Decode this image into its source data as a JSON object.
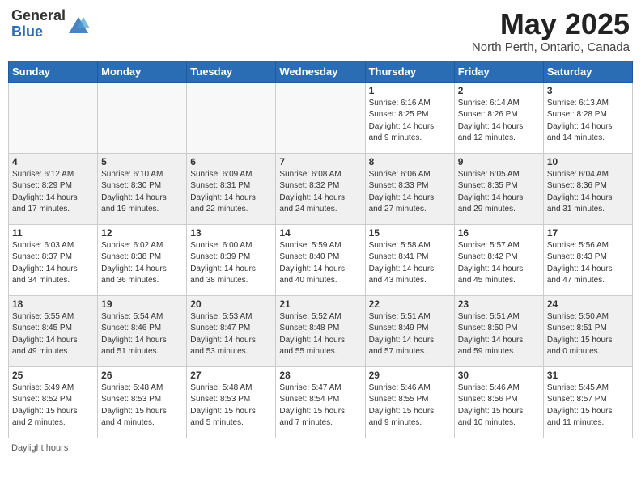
{
  "header": {
    "logo_general": "General",
    "logo_blue": "Blue",
    "month_title": "May 2025",
    "location": "North Perth, Ontario, Canada"
  },
  "days_of_week": [
    "Sunday",
    "Monday",
    "Tuesday",
    "Wednesday",
    "Thursday",
    "Friday",
    "Saturday"
  ],
  "footer": {
    "note": "Daylight hours"
  },
  "weeks": [
    [
      {
        "day": "",
        "info": ""
      },
      {
        "day": "",
        "info": ""
      },
      {
        "day": "",
        "info": ""
      },
      {
        "day": "",
        "info": ""
      },
      {
        "day": "1",
        "info": "Sunrise: 6:16 AM\nSunset: 8:25 PM\nDaylight: 14 hours\nand 9 minutes."
      },
      {
        "day": "2",
        "info": "Sunrise: 6:14 AM\nSunset: 8:26 PM\nDaylight: 14 hours\nand 12 minutes."
      },
      {
        "day": "3",
        "info": "Sunrise: 6:13 AM\nSunset: 8:28 PM\nDaylight: 14 hours\nand 14 minutes."
      }
    ],
    [
      {
        "day": "4",
        "info": "Sunrise: 6:12 AM\nSunset: 8:29 PM\nDaylight: 14 hours\nand 17 minutes."
      },
      {
        "day": "5",
        "info": "Sunrise: 6:10 AM\nSunset: 8:30 PM\nDaylight: 14 hours\nand 19 minutes."
      },
      {
        "day": "6",
        "info": "Sunrise: 6:09 AM\nSunset: 8:31 PM\nDaylight: 14 hours\nand 22 minutes."
      },
      {
        "day": "7",
        "info": "Sunrise: 6:08 AM\nSunset: 8:32 PM\nDaylight: 14 hours\nand 24 minutes."
      },
      {
        "day": "8",
        "info": "Sunrise: 6:06 AM\nSunset: 8:33 PM\nDaylight: 14 hours\nand 27 minutes."
      },
      {
        "day": "9",
        "info": "Sunrise: 6:05 AM\nSunset: 8:35 PM\nDaylight: 14 hours\nand 29 minutes."
      },
      {
        "day": "10",
        "info": "Sunrise: 6:04 AM\nSunset: 8:36 PM\nDaylight: 14 hours\nand 31 minutes."
      }
    ],
    [
      {
        "day": "11",
        "info": "Sunrise: 6:03 AM\nSunset: 8:37 PM\nDaylight: 14 hours\nand 34 minutes."
      },
      {
        "day": "12",
        "info": "Sunrise: 6:02 AM\nSunset: 8:38 PM\nDaylight: 14 hours\nand 36 minutes."
      },
      {
        "day": "13",
        "info": "Sunrise: 6:00 AM\nSunset: 8:39 PM\nDaylight: 14 hours\nand 38 minutes."
      },
      {
        "day": "14",
        "info": "Sunrise: 5:59 AM\nSunset: 8:40 PM\nDaylight: 14 hours\nand 40 minutes."
      },
      {
        "day": "15",
        "info": "Sunrise: 5:58 AM\nSunset: 8:41 PM\nDaylight: 14 hours\nand 43 minutes."
      },
      {
        "day": "16",
        "info": "Sunrise: 5:57 AM\nSunset: 8:42 PM\nDaylight: 14 hours\nand 45 minutes."
      },
      {
        "day": "17",
        "info": "Sunrise: 5:56 AM\nSunset: 8:43 PM\nDaylight: 14 hours\nand 47 minutes."
      }
    ],
    [
      {
        "day": "18",
        "info": "Sunrise: 5:55 AM\nSunset: 8:45 PM\nDaylight: 14 hours\nand 49 minutes."
      },
      {
        "day": "19",
        "info": "Sunrise: 5:54 AM\nSunset: 8:46 PM\nDaylight: 14 hours\nand 51 minutes."
      },
      {
        "day": "20",
        "info": "Sunrise: 5:53 AM\nSunset: 8:47 PM\nDaylight: 14 hours\nand 53 minutes."
      },
      {
        "day": "21",
        "info": "Sunrise: 5:52 AM\nSunset: 8:48 PM\nDaylight: 14 hours\nand 55 minutes."
      },
      {
        "day": "22",
        "info": "Sunrise: 5:51 AM\nSunset: 8:49 PM\nDaylight: 14 hours\nand 57 minutes."
      },
      {
        "day": "23",
        "info": "Sunrise: 5:51 AM\nSunset: 8:50 PM\nDaylight: 14 hours\nand 59 minutes."
      },
      {
        "day": "24",
        "info": "Sunrise: 5:50 AM\nSunset: 8:51 PM\nDaylight: 15 hours\nand 0 minutes."
      }
    ],
    [
      {
        "day": "25",
        "info": "Sunrise: 5:49 AM\nSunset: 8:52 PM\nDaylight: 15 hours\nand 2 minutes."
      },
      {
        "day": "26",
        "info": "Sunrise: 5:48 AM\nSunset: 8:53 PM\nDaylight: 15 hours\nand 4 minutes."
      },
      {
        "day": "27",
        "info": "Sunrise: 5:48 AM\nSunset: 8:53 PM\nDaylight: 15 hours\nand 5 minutes."
      },
      {
        "day": "28",
        "info": "Sunrise: 5:47 AM\nSunset: 8:54 PM\nDaylight: 15 hours\nand 7 minutes."
      },
      {
        "day": "29",
        "info": "Sunrise: 5:46 AM\nSunset: 8:55 PM\nDaylight: 15 hours\nand 9 minutes."
      },
      {
        "day": "30",
        "info": "Sunrise: 5:46 AM\nSunset: 8:56 PM\nDaylight: 15 hours\nand 10 minutes."
      },
      {
        "day": "31",
        "info": "Sunrise: 5:45 AM\nSunset: 8:57 PM\nDaylight: 15 hours\nand 11 minutes."
      }
    ]
  ]
}
